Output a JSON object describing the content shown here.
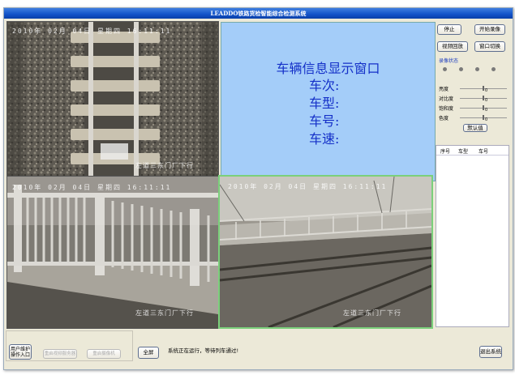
{
  "window": {
    "title": "LEADDO铁路货检智能综合检测系统"
  },
  "cameras": [
    {
      "id": "cam-top",
      "date_text": "2010年 02月 04日  星期四  16:11:11",
      "location": ""
    },
    {
      "id": "cam-left",
      "date_text": "2010年 02月 04日  星期四  16:11:11",
      "location": ""
    },
    {
      "id": "cam-right",
      "date_text": "2010年 02月 04日  星期四  16:11:11",
      "location": "左道三东门厂下行"
    },
    {
      "id": "cam-bottom-left",
      "location": "左道三东门厂下行"
    },
    {
      "id": "cam-top-loc",
      "location": "左道三东门厂下行"
    }
  ],
  "vehicle_info": {
    "title": "车辆信息显示窗口",
    "train_no": "车次:",
    "model": "车型:",
    "car_no": "车号:",
    "speed": "车速:"
  },
  "controls": {
    "stop": "停止",
    "start_record": "开始录像",
    "video_playback": "视频回放",
    "window_switch": "窗口切换",
    "record_status": "录像状态",
    "brightness": "亮度",
    "contrast": "对比度",
    "saturation": "饱和度",
    "hue": "色度",
    "brightness_val": "0",
    "contrast_val": "0",
    "saturation_val": "0",
    "hue_val": "0",
    "default": "默认值"
  },
  "table": {
    "headers": [
      "序号",
      "车型",
      "车号"
    ]
  },
  "bottom": {
    "user_maintenance": "用户维护",
    "operation_entry": "操作入口",
    "restart_video_server": "重启视频服务器",
    "restart_host": "重启摄像机",
    "fullscreen": "全屏",
    "status": "系统正在运行，等待列车通过!",
    "exit": "退出系统"
  },
  "colors": {
    "title_bar": "#1253c8",
    "info_bg": "#a4cdf9",
    "info_text": "#1430c8",
    "active_border": "#7bd07b"
  }
}
